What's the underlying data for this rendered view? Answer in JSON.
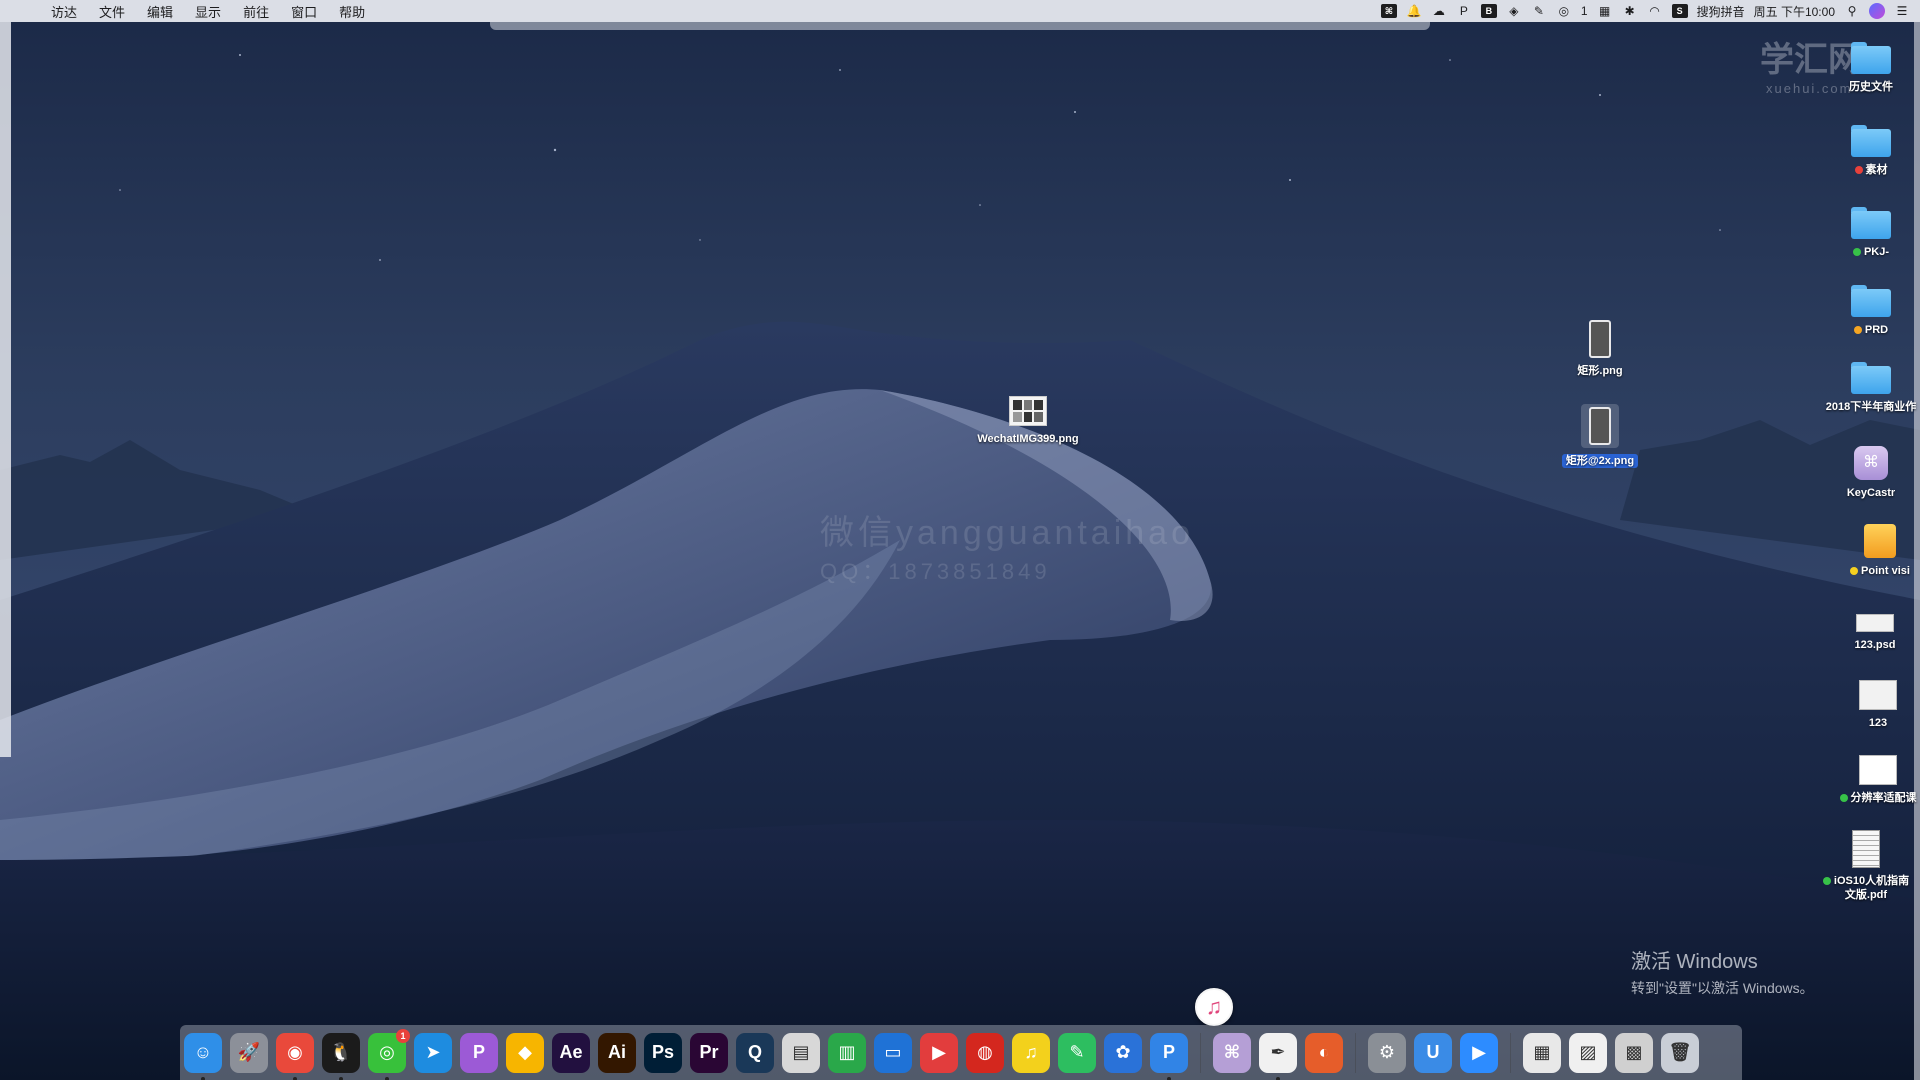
{
  "menubar": {
    "menus": [
      "访达",
      "文件",
      "编辑",
      "显示",
      "前往",
      "窗口",
      "帮助"
    ],
    "status_icons": [
      "keycastr-icon",
      "bell-icon",
      "creative-cloud-icon",
      "paw-icon",
      "bold-b-icon",
      "pen-icon",
      "wifi-dots-icon"
    ],
    "wechat_count": "1",
    "input_method": "搜狗拼音",
    "clock": "周五 下午10:00"
  },
  "desktop": {
    "center_file": "WechatIMG399.png",
    "selected_file": "矩形@2x.png",
    "file_rect": "矩形.png",
    "sidebar_items": [
      {
        "label": "历史文件",
        "kind": "folder",
        "tag": ""
      },
      {
        "label": "素材",
        "kind": "folder",
        "tag": "#e8413b"
      },
      {
        "label": "PKJ-",
        "kind": "folder",
        "tag": "#37c248"
      },
      {
        "label": "PRD",
        "kind": "folder",
        "tag": "#f5a623"
      },
      {
        "label": "2018下半年商业作",
        "kind": "folder",
        "tag": ""
      },
      {
        "label": "KeyCastr",
        "kind": "app",
        "tag": ""
      },
      {
        "label": "Point visi",
        "kind": "app",
        "tag": "#f5d020"
      },
      {
        "label": "123.psd",
        "kind": "doc",
        "tag": ""
      },
      {
        "label": "123",
        "kind": "doc",
        "tag": ""
      },
      {
        "label": "分辨率适配课",
        "kind": "doc",
        "tag": "#37c248"
      },
      {
        "label": "iOS10人机指南文版.pdf",
        "kind": "pdf",
        "tag": "#37c248"
      }
    ]
  },
  "watermarks": {
    "center_line1": "微信yangguantaihao",
    "center_line2": "QQ：1873851849",
    "brand": "学汇网",
    "brand_sub": "xuehui.com"
  },
  "activation": {
    "title": "激活 Windows",
    "subtitle": "转到\"设置\"以激活 Windows。"
  },
  "dock": {
    "apps": [
      {
        "name": "finder",
        "glyph": "☺",
        "bg": "#2f8fe8",
        "running": true
      },
      {
        "name": "launchpad",
        "glyph": "🚀",
        "bg": "#8c9099",
        "running": false
      },
      {
        "name": "chrome",
        "glyph": "◉",
        "bg": "#e9493b",
        "running": true
      },
      {
        "name": "qq",
        "glyph": "🐧",
        "bg": "#1b1b1b",
        "running": true
      },
      {
        "name": "wechat",
        "glyph": "◎",
        "bg": "#38c13b",
        "running": true
      },
      {
        "name": "maxthon",
        "glyph": "➤",
        "bg": "#1e8ce0",
        "running": false
      },
      {
        "name": "pockity",
        "glyph": "P",
        "bg": "#9c5ad6",
        "running": false
      },
      {
        "name": "sketch",
        "glyph": "◆",
        "bg": "#f7b500",
        "running": false
      },
      {
        "name": "after-effects",
        "glyph": "Ae",
        "bg": "#22103f",
        "running": false
      },
      {
        "name": "illustrator",
        "glyph": "Ai",
        "bg": "#331700",
        "running": false
      },
      {
        "name": "photoshop",
        "glyph": "Ps",
        "bg": "#001e36",
        "running": false
      },
      {
        "name": "premiere",
        "glyph": "Pr",
        "bg": "#2a0634",
        "running": false
      },
      {
        "name": "quicktime",
        "glyph": "Q",
        "bg": "#1a3858",
        "running": false
      },
      {
        "name": "preview",
        "glyph": "▤",
        "bg": "#d8d8d8",
        "running": false
      },
      {
        "name": "numbers",
        "glyph": "▥",
        "bg": "#2aa84a",
        "running": false
      },
      {
        "name": "keynote",
        "glyph": "▭",
        "bg": "#1f72d6",
        "running": false
      },
      {
        "name": "video-player",
        "glyph": "▶",
        "bg": "#e23d3d",
        "running": false
      },
      {
        "name": "netease-music",
        "glyph": "◍",
        "bg": "#d4271e",
        "running": false
      },
      {
        "name": "qq-music",
        "glyph": "♫",
        "bg": "#f3d11c",
        "running": false
      },
      {
        "name": "evernote",
        "glyph": "✎",
        "bg": "#2dbe60",
        "running": false
      },
      {
        "name": "pixelmator",
        "glyph": "✿",
        "bg": "#2a72d8",
        "running": false
      },
      {
        "name": "pages-p",
        "glyph": "P",
        "bg": "#3184e6",
        "running": true
      }
    ],
    "apps_right": [
      {
        "name": "keycastr",
        "glyph": "⌘",
        "bg": "#b59fd6",
        "running": false
      },
      {
        "name": "script-editor",
        "glyph": "✒",
        "bg": "#f1f1f1",
        "running": true
      },
      {
        "name": "airship",
        "glyph": "◐",
        "bg": "#e65d2a",
        "running": false
      }
    ],
    "apps_utility": [
      {
        "name": "system-preferences",
        "glyph": "⚙",
        "bg": "#8a8f96",
        "running": false
      },
      {
        "name": "ushield",
        "glyph": "U",
        "bg": "#3a8be6",
        "running": false
      },
      {
        "name": "zoom",
        "glyph": "▶",
        "bg": "#2d8cff",
        "running": false
      }
    ],
    "stacks": [
      {
        "name": "screenshot-stack",
        "glyph": "▦",
        "bg": "#e8e8e8"
      },
      {
        "name": "downloads-stack",
        "glyph": "▨",
        "bg": "#f0f0f0"
      },
      {
        "name": "documents-stack",
        "glyph": "▩",
        "bg": "#d0d0d0"
      },
      {
        "name": "trash",
        "glyph": "🗑",
        "bg": "#c9ced6"
      }
    ],
    "bouncing": {
      "name": "itunes",
      "glyph": "♫"
    }
  }
}
